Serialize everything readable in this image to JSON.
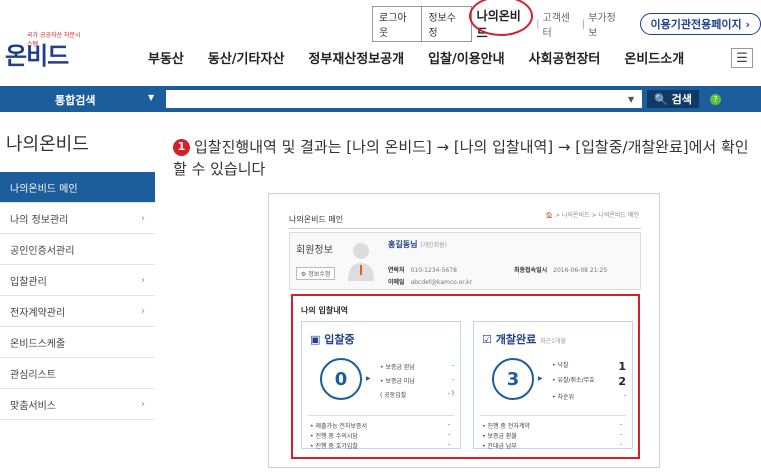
{
  "header": {
    "top_links": {
      "logout": "로그아웃",
      "edit_info": "정보수정",
      "my_onbid": "나의온비드",
      "customer_center": "고객센터",
      "extra_info": "부가정보",
      "org_page": "이용기관전용페이지 ›"
    },
    "logo": {
      "small_text": "국가 공공자산 처분시스템",
      "main_text": "온비드"
    },
    "nav": [
      "부동산",
      "동산/기타자산",
      "정부재산정보공개",
      "입찰/이용안내",
      "사회공헌장터",
      "온비드소개"
    ],
    "menu_icon": "hamburger-icon"
  },
  "search_bar": {
    "label": "통합검색",
    "button_label": "🔍 검색",
    "help_label": "?"
  },
  "sidebar": {
    "title": "나의온비드",
    "items": [
      {
        "label": "나의온비드 메인",
        "active": true
      },
      {
        "label": "나의 정보관리"
      },
      {
        "label": "공인인증서관리"
      },
      {
        "label": "입찰관리"
      },
      {
        "label": "전자계약관리"
      },
      {
        "label": "온비드스케줄"
      },
      {
        "label": "관심리스트"
      },
      {
        "label": "맞춤서비스"
      }
    ]
  },
  "instruction": {
    "number": "1",
    "text": "입찰진행내역 및 결과는 [나의 온비드] → [나의 입찰내역] → [입찰중/개찰완료]에서 확인할 수 있습니다"
  },
  "inner_screen": {
    "title": "나의온비드 메인",
    "breadcrumb": "🏠 > 나의온비드 > 나의온비드 메인",
    "member": {
      "title": "회원정보",
      "edit_button": "⚙ 정보수정",
      "name": "홍길동님",
      "name_type": "(개인회원)",
      "phone_label": "연락처",
      "phone_value": "010-1234-5678",
      "email_label": "이메일",
      "email_value": "abcdef@kamco.or.kr",
      "last_login_label": "최종접속일시",
      "last_login_value": "2016-06-08 21:25"
    },
    "bids": {
      "title": "나의 입찰내역",
      "in_progress": {
        "title": "입찰중",
        "count": "0",
        "items": [
          {
            "label": "• 보증금 완납",
            "value": "-"
          },
          {
            "label": "• 보증금 미납",
            "value": "-"
          },
          {
            "label": "( 공동입찰",
            "value": "- )"
          }
        ],
        "bottom": [
          {
            "label": "• 제출가능 전자보증서",
            "value": "-"
          },
          {
            "label": "• 진행 중 수의시담",
            "value": "-"
          },
          {
            "label": "• 진행 중 호가입찰",
            "value": "-"
          }
        ]
      },
      "completed": {
        "title": "개찰완료",
        "subtitle": "최근1개월",
        "count": "3",
        "items": [
          {
            "label": "• 낙찰",
            "value": "1"
          },
          {
            "label": "• 유찰/취소/무효",
            "value": "2"
          },
          {
            "label": "• 차순위",
            "value": "-"
          }
        ],
        "bottom": [
          {
            "label": "• 진행 중 전자계약",
            "value": "-"
          },
          {
            "label": "• 보증금 환불",
            "value": "-"
          },
          {
            "label": "• 잔대금 납부",
            "value": "-"
          }
        ]
      }
    }
  },
  "colors": {
    "brand_blue": "#1c5d9b",
    "navy": "#203f8c",
    "highlight_red": "#d4202a"
  }
}
